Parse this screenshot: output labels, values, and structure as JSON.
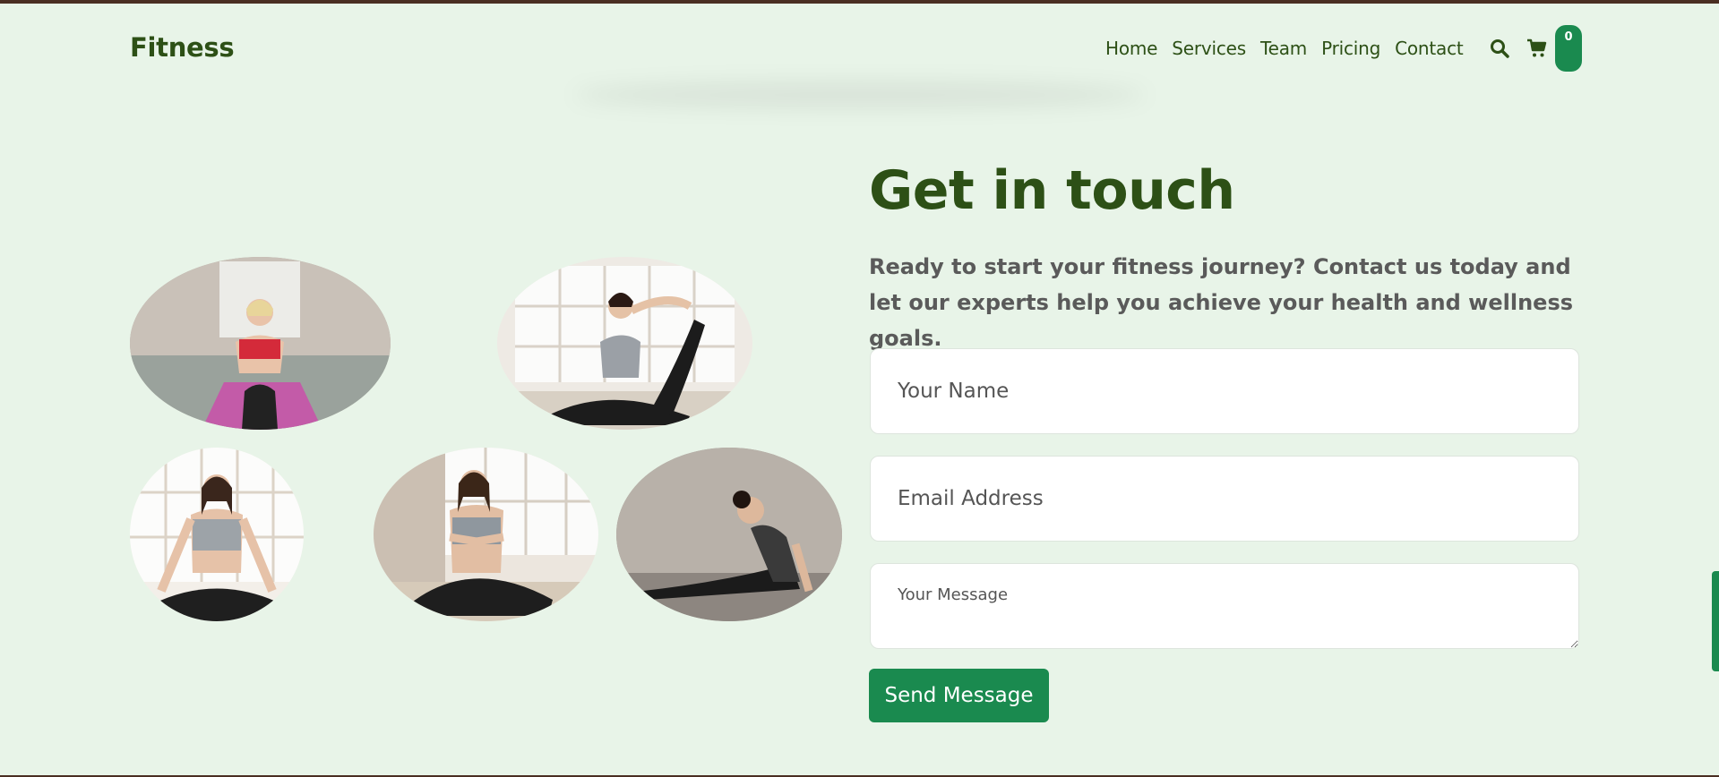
{
  "brand": "Fitness",
  "nav": {
    "items": [
      {
        "label": "Home"
      },
      {
        "label": "Services"
      },
      {
        "label": "Team"
      },
      {
        "label": "Pricing"
      },
      {
        "label": "Contact"
      }
    ]
  },
  "cart": {
    "count": "0"
  },
  "icons": {
    "search": "search-icon",
    "cart": "cart-icon"
  },
  "contact": {
    "title": "Get in touch",
    "lead": "Ready to start your fitness journey? Contact us today and let our experts help you achieve your health and wellness goals.",
    "name_placeholder": "Your Name",
    "email_placeholder": "Email Address",
    "message_placeholder": "Your Message",
    "send_label": "Send Message"
  },
  "gallery": {
    "photos": [
      {
        "subject": "woman doing crunches on pink mat"
      },
      {
        "subject": "woman in pigeon pose stretch"
      },
      {
        "subject": "woman meditating in lotus pose"
      },
      {
        "subject": "woman in seated twist with prayer hands"
      },
      {
        "subject": "woman in cobra pose"
      }
    ]
  },
  "colors": {
    "background": "#e8f4e8",
    "brand_text": "#2d5016",
    "accent": "#1a8a4f",
    "body_text": "#5a5a5a",
    "top_strip": "#4a2e22"
  }
}
